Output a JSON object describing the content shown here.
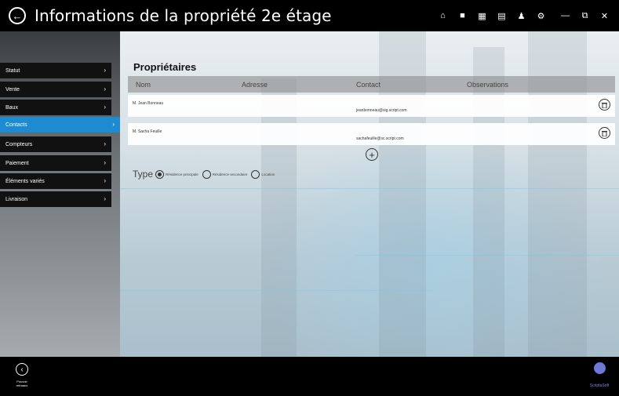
{
  "window": {
    "title": "Informations de la propriété 2e étage",
    "back_icon": "←",
    "toolbar_icons": [
      {
        "name": "home-icon",
        "glyph": "⌂"
      },
      {
        "name": "camera-icon",
        "glyph": "■"
      },
      {
        "name": "grid-icon",
        "glyph": "▦"
      },
      {
        "name": "window-icon",
        "glyph": "▤"
      },
      {
        "name": "user-icon",
        "glyph": "♟"
      },
      {
        "name": "gear-icon",
        "glyph": "⚙"
      },
      {
        "name": "minimize-icon",
        "glyph": "—"
      },
      {
        "name": "restore-icon",
        "glyph": "⧉"
      },
      {
        "name": "close-icon",
        "glyph": "✕"
      }
    ]
  },
  "sidebar": {
    "items": [
      {
        "label": "Statut",
        "active": false
      },
      {
        "label": "Vente",
        "active": false
      },
      {
        "label": "Baux",
        "active": false
      },
      {
        "label": "Contacts",
        "active": true
      },
      {
        "label": "Compteurs",
        "active": false
      },
      {
        "label": "Paiement",
        "active": false
      },
      {
        "label": "Éléments variés",
        "active": false
      },
      {
        "label": "Livraison",
        "active": false
      }
    ],
    "chevron": "›"
  },
  "owners": {
    "heading": "Propriétaires",
    "columns": {
      "name": "Nom",
      "address": "Adresse",
      "contact": "Contact",
      "observations": "Observations"
    },
    "rows": [
      {
        "name": "M. Jean Bonneau",
        "contact": "jeanbonneau@sig.script.com"
      },
      {
        "name": "M. Sacha Feuille",
        "contact": "sachafeuille@sc.script.com"
      }
    ],
    "add_glyph": "+"
  },
  "type": {
    "label": "Type",
    "options": [
      {
        "label": "Résidence principale",
        "checked": true
      },
      {
        "label": "Résidence secondaire",
        "checked": false
      },
      {
        "label": "Location",
        "checked": false
      }
    ]
  },
  "bottom": {
    "prev_label_line1": "Pouvoir",
    "prev_label_line2": "retraaux",
    "logo_text": "ScriptaSoft"
  }
}
